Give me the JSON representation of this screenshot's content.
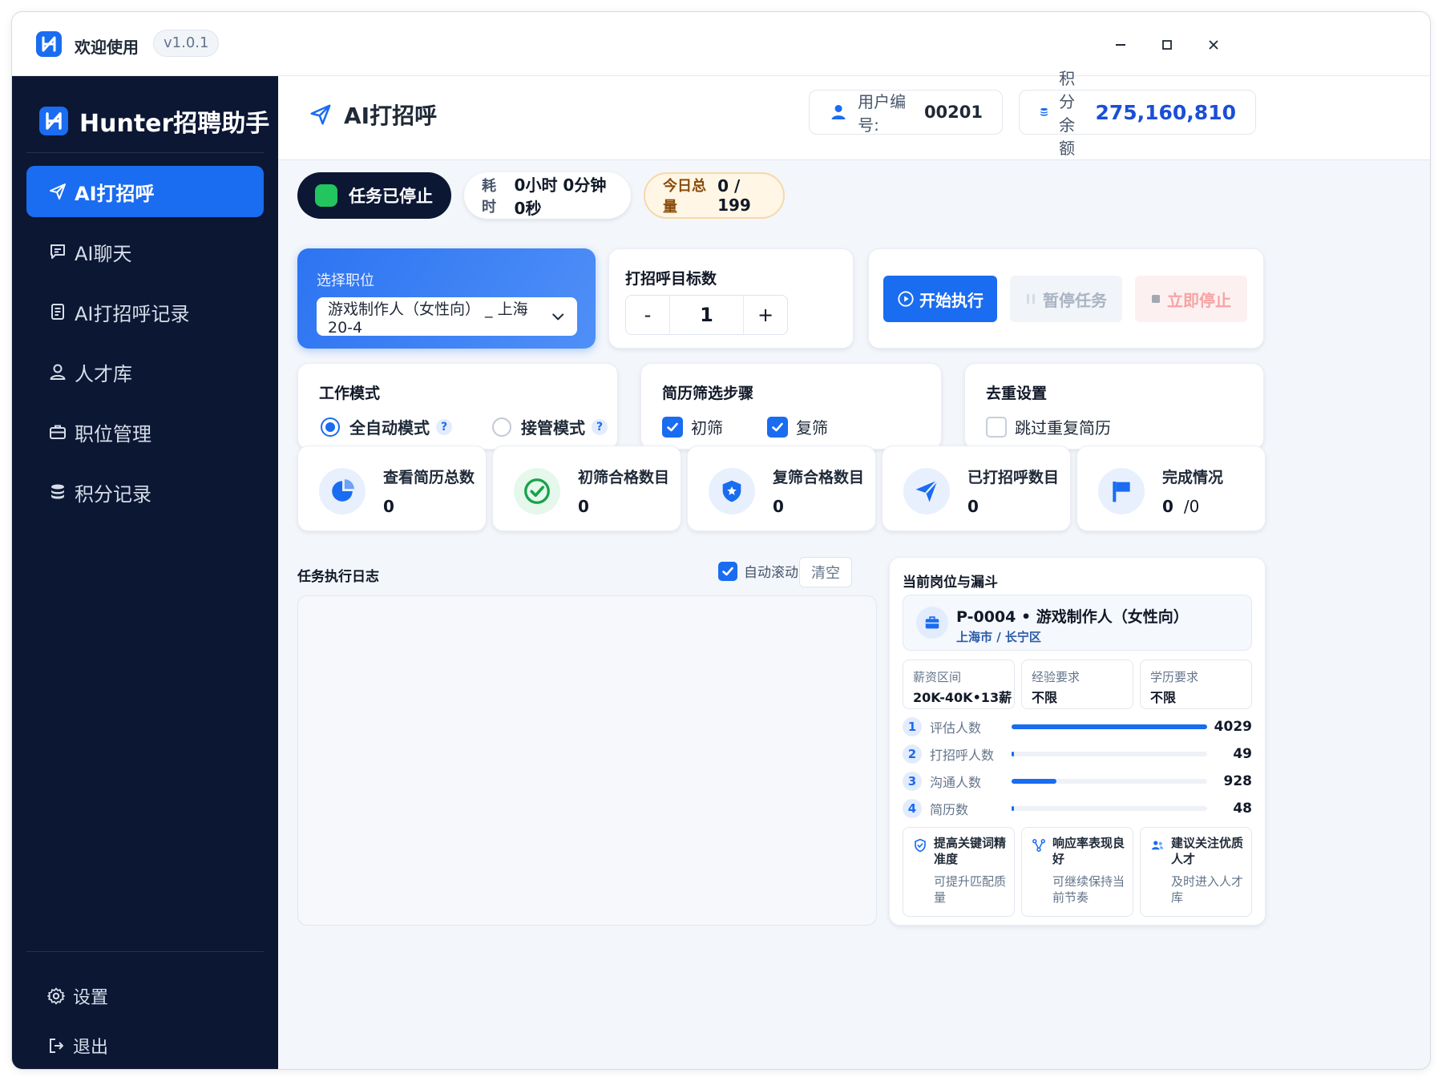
{
  "titlebar": {
    "title": "欢迎使用",
    "version": "v1.0.1",
    "minimize": "—",
    "maximize": "☐",
    "close": "✕"
  },
  "sidebar": {
    "brand": "Hunter招聘助手",
    "items": [
      {
        "label": "AI打招呼",
        "icon": "send-icon",
        "active": true
      },
      {
        "label": "AI聊天",
        "icon": "chat-icon",
        "active": false
      },
      {
        "label": "AI打招呼记录",
        "icon": "document-icon",
        "active": false
      },
      {
        "label": "人才库",
        "icon": "user-icon",
        "active": false
      },
      {
        "label": "职位管理",
        "icon": "briefcase-icon",
        "active": false
      },
      {
        "label": "积分记录",
        "icon": "database-icon",
        "active": false
      }
    ],
    "settings": "设置",
    "logout": "退出"
  },
  "header": {
    "title": "AI打招呼",
    "user_label": "用户编号:",
    "user_id": "00201",
    "points_label": "积分余额",
    "points_value": "275,160,810"
  },
  "status": {
    "task_state": "任务已停止",
    "elapsed_label": "耗时",
    "elapsed_value": "0小时 0分钟 0秒",
    "today_label": "今日总量",
    "today_value": "0 / 199"
  },
  "position": {
    "label": "选择职位",
    "selected": "游戏制作人（女性向） _ 上海 20-4"
  },
  "target": {
    "label": "打招呼目标数",
    "minus": "-",
    "value": "1",
    "plus": "+"
  },
  "actions": {
    "start": "开始执行",
    "pause": "暂停任务",
    "stop": "立即停止"
  },
  "work_mode": {
    "title": "工作模式",
    "auto": "全自动模式",
    "takeover": "接管模式",
    "selected": "auto",
    "help": "?"
  },
  "screening": {
    "title": "简历筛选步骤",
    "first": "初筛",
    "second": "复筛",
    "first_checked": true,
    "second_checked": true
  },
  "dedupe": {
    "title": "去重设置",
    "skip": "跳过重复简历",
    "checked": false
  },
  "stats": [
    {
      "label": "查看简历总数",
      "value": "0",
      "icon": "pie-chart-icon",
      "color": "#1a6cf0"
    },
    {
      "label": "初筛合格数目",
      "value": "0",
      "icon": "check-circle-icon",
      "color": "#16a34a"
    },
    {
      "label": "复筛合格数目",
      "value": "0",
      "icon": "shield-star-icon",
      "color": "#1a6cf0"
    },
    {
      "label": "已打招呼数目",
      "value": "0",
      "icon": "send-icon",
      "color": "#1a6cf0"
    },
    {
      "label": "完成情况",
      "value": "0",
      "value_suffix": "/0",
      "icon": "flag-icon",
      "color": "#1a6cf0"
    }
  ],
  "log": {
    "title": "任务执行日志",
    "autoscroll": "自动滚动",
    "autoscroll_checked": true,
    "clear": "清空"
  },
  "funnel": {
    "title": "当前岗位与漏斗",
    "job_title": "P-0004 • 游戏制作人（女性向）",
    "job_location": "上海市 / 长宁区",
    "requirements": [
      {
        "label": "薪资区间",
        "value": "20K-40K•13薪"
      },
      {
        "label": "经验要求",
        "value": "不限"
      },
      {
        "label": "学历要求",
        "value": "不限"
      }
    ],
    "rows": [
      {
        "num": "1",
        "label": "评估人数",
        "value": "4029",
        "fill": 1.0
      },
      {
        "num": "2",
        "label": "打招呼人数",
        "value": "49",
        "fill": 0.012
      },
      {
        "num": "3",
        "label": "沟通人数",
        "value": "928",
        "fill": 0.23
      },
      {
        "num": "4",
        "label": "简历数",
        "value": "48",
        "fill": 0.012
      }
    ],
    "tips": [
      {
        "title": "提高关键词精准度",
        "desc": "可提升匹配质量",
        "icon": "shield-check-icon"
      },
      {
        "title": "响应率表现良好",
        "desc": "可继续保持当前节奏",
        "icon": "share-node-icon"
      },
      {
        "title": "建议关注优质人才",
        "desc": "及时进入人才库",
        "icon": "users-icon"
      }
    ]
  },
  "colors": {
    "accent": "#1a6cf0",
    "sidebar_bg": "#0b1733",
    "success": "#22c55e"
  }
}
